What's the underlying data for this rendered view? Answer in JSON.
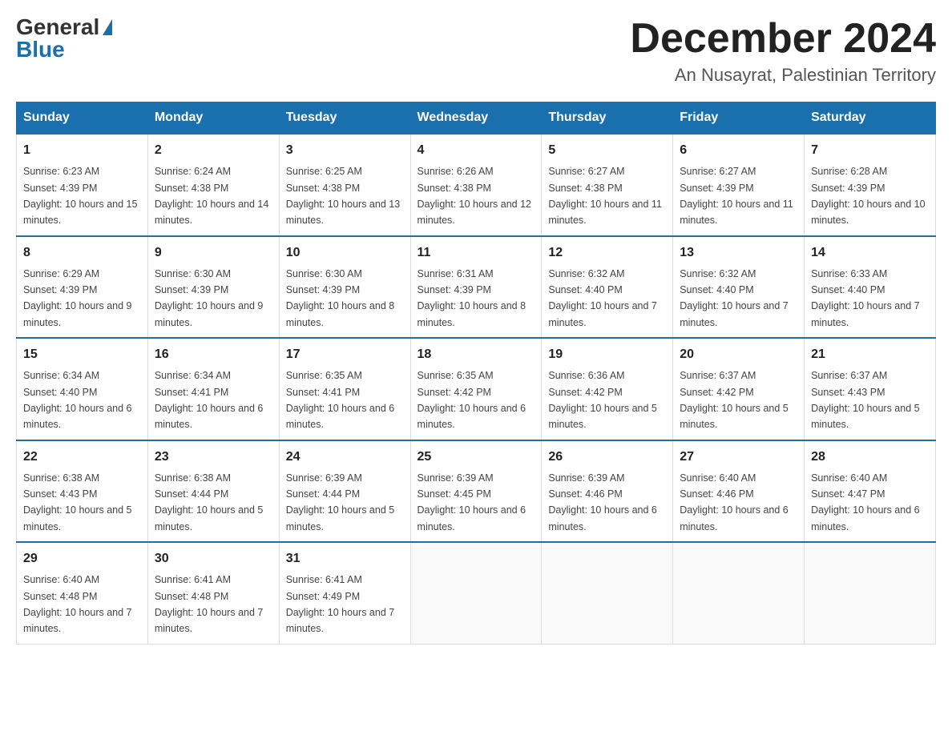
{
  "logo": {
    "general": "General",
    "blue": "Blue",
    "triangle": "▲"
  },
  "title": "December 2024",
  "location": "An Nusayrat, Palestinian Territory",
  "days_of_week": [
    "Sunday",
    "Monday",
    "Tuesday",
    "Wednesday",
    "Thursday",
    "Friday",
    "Saturday"
  ],
  "weeks": [
    [
      {
        "day": "1",
        "sunrise": "6:23 AM",
        "sunset": "4:39 PM",
        "daylight": "10 hours and 15 minutes."
      },
      {
        "day": "2",
        "sunrise": "6:24 AM",
        "sunset": "4:38 PM",
        "daylight": "10 hours and 14 minutes."
      },
      {
        "day": "3",
        "sunrise": "6:25 AM",
        "sunset": "4:38 PM",
        "daylight": "10 hours and 13 minutes."
      },
      {
        "day": "4",
        "sunrise": "6:26 AM",
        "sunset": "4:38 PM",
        "daylight": "10 hours and 12 minutes."
      },
      {
        "day": "5",
        "sunrise": "6:27 AM",
        "sunset": "4:38 PM",
        "daylight": "10 hours and 11 minutes."
      },
      {
        "day": "6",
        "sunrise": "6:27 AM",
        "sunset": "4:39 PM",
        "daylight": "10 hours and 11 minutes."
      },
      {
        "day": "7",
        "sunrise": "6:28 AM",
        "sunset": "4:39 PM",
        "daylight": "10 hours and 10 minutes."
      }
    ],
    [
      {
        "day": "8",
        "sunrise": "6:29 AM",
        "sunset": "4:39 PM",
        "daylight": "10 hours and 9 minutes."
      },
      {
        "day": "9",
        "sunrise": "6:30 AM",
        "sunset": "4:39 PM",
        "daylight": "10 hours and 9 minutes."
      },
      {
        "day": "10",
        "sunrise": "6:30 AM",
        "sunset": "4:39 PM",
        "daylight": "10 hours and 8 minutes."
      },
      {
        "day": "11",
        "sunrise": "6:31 AM",
        "sunset": "4:39 PM",
        "daylight": "10 hours and 8 minutes."
      },
      {
        "day": "12",
        "sunrise": "6:32 AM",
        "sunset": "4:40 PM",
        "daylight": "10 hours and 7 minutes."
      },
      {
        "day": "13",
        "sunrise": "6:32 AM",
        "sunset": "4:40 PM",
        "daylight": "10 hours and 7 minutes."
      },
      {
        "day": "14",
        "sunrise": "6:33 AM",
        "sunset": "4:40 PM",
        "daylight": "10 hours and 7 minutes."
      }
    ],
    [
      {
        "day": "15",
        "sunrise": "6:34 AM",
        "sunset": "4:40 PM",
        "daylight": "10 hours and 6 minutes."
      },
      {
        "day": "16",
        "sunrise": "6:34 AM",
        "sunset": "4:41 PM",
        "daylight": "10 hours and 6 minutes."
      },
      {
        "day": "17",
        "sunrise": "6:35 AM",
        "sunset": "4:41 PM",
        "daylight": "10 hours and 6 minutes."
      },
      {
        "day": "18",
        "sunrise": "6:35 AM",
        "sunset": "4:42 PM",
        "daylight": "10 hours and 6 minutes."
      },
      {
        "day": "19",
        "sunrise": "6:36 AM",
        "sunset": "4:42 PM",
        "daylight": "10 hours and 5 minutes."
      },
      {
        "day": "20",
        "sunrise": "6:37 AM",
        "sunset": "4:42 PM",
        "daylight": "10 hours and 5 minutes."
      },
      {
        "day": "21",
        "sunrise": "6:37 AM",
        "sunset": "4:43 PM",
        "daylight": "10 hours and 5 minutes."
      }
    ],
    [
      {
        "day": "22",
        "sunrise": "6:38 AM",
        "sunset": "4:43 PM",
        "daylight": "10 hours and 5 minutes."
      },
      {
        "day": "23",
        "sunrise": "6:38 AM",
        "sunset": "4:44 PM",
        "daylight": "10 hours and 5 minutes."
      },
      {
        "day": "24",
        "sunrise": "6:39 AM",
        "sunset": "4:44 PM",
        "daylight": "10 hours and 5 minutes."
      },
      {
        "day": "25",
        "sunrise": "6:39 AM",
        "sunset": "4:45 PM",
        "daylight": "10 hours and 6 minutes."
      },
      {
        "day": "26",
        "sunrise": "6:39 AM",
        "sunset": "4:46 PM",
        "daylight": "10 hours and 6 minutes."
      },
      {
        "day": "27",
        "sunrise": "6:40 AM",
        "sunset": "4:46 PM",
        "daylight": "10 hours and 6 minutes."
      },
      {
        "day": "28",
        "sunrise": "6:40 AM",
        "sunset": "4:47 PM",
        "daylight": "10 hours and 6 minutes."
      }
    ],
    [
      {
        "day": "29",
        "sunrise": "6:40 AM",
        "sunset": "4:48 PM",
        "daylight": "10 hours and 7 minutes."
      },
      {
        "day": "30",
        "sunrise": "6:41 AM",
        "sunset": "4:48 PM",
        "daylight": "10 hours and 7 minutes."
      },
      {
        "day": "31",
        "sunrise": "6:41 AM",
        "sunset": "4:49 PM",
        "daylight": "10 hours and 7 minutes."
      },
      null,
      null,
      null,
      null
    ]
  ]
}
